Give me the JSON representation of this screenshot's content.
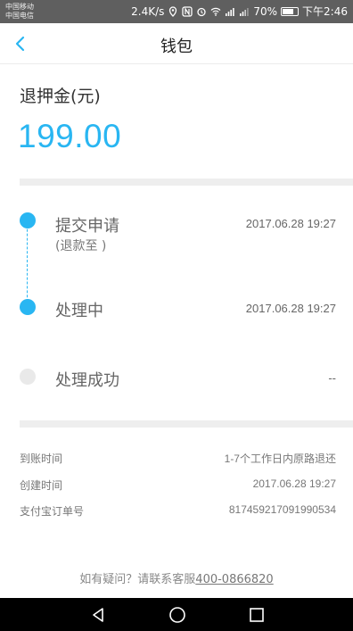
{
  "status_bar": {
    "carrier1": "中国移动",
    "carrier2": "中国电信",
    "speed": "2.4K/s",
    "battery": "70%",
    "time": "下午2:46"
  },
  "header": {
    "title": "钱包",
    "back_icon": "chevron-left-icon"
  },
  "refund": {
    "label": "退押金(元)",
    "amount": "199.00",
    "accent_color": "#29b6f2"
  },
  "timeline": [
    {
      "label": "提交申请",
      "sub": "(退款至 )",
      "time": "2017.06.28 19:27",
      "state": "done"
    },
    {
      "label": "处理中",
      "time": "2017.06.28 19:27",
      "state": "done"
    },
    {
      "label": "处理成功",
      "time": "--",
      "state": "pending"
    }
  ],
  "details": [
    {
      "label": "到账时间",
      "value": "1-7个工作日内原路退还"
    },
    {
      "label": "创建时间",
      "value": "2017.06.28 19:27"
    },
    {
      "label": "支付宝订单号",
      "value": "817459217091990534"
    }
  ],
  "help": {
    "prefix": "如有疑问？请联系客服",
    "phone": "400-0866820"
  },
  "nav_keys": [
    "back-triangle-icon",
    "home-circle-icon",
    "recents-square-icon"
  ]
}
